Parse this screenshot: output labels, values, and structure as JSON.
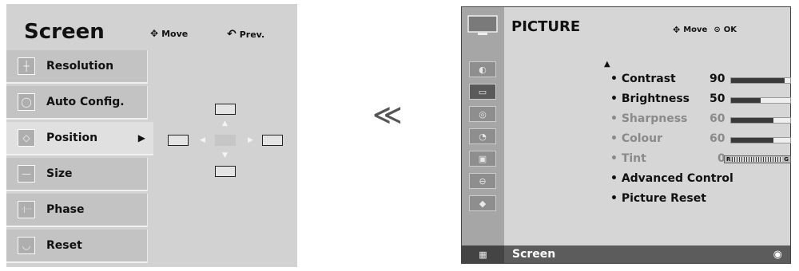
{
  "screen_menu": {
    "title": "Screen",
    "move_hint": "Move",
    "prev_hint": "Prev.",
    "items": [
      {
        "label": "Resolution",
        "icon": "resolution-icon"
      },
      {
        "label": "Auto Config.",
        "icon": "auto-config-icon"
      },
      {
        "label": "Position",
        "icon": "position-icon",
        "selected": true
      },
      {
        "label": "Size",
        "icon": "size-icon"
      },
      {
        "label": "Phase",
        "icon": "phase-icon"
      },
      {
        "label": "Reset",
        "icon": "reset-icon"
      }
    ]
  },
  "separator": "≪",
  "picture_menu": {
    "title": "PICTURE",
    "move_hint": "Move",
    "ok_hint": "OK",
    "rows": [
      {
        "label": "• Contrast",
        "value": "90",
        "level": 90
      },
      {
        "label": "• Brightness",
        "value": "50",
        "level": 50
      },
      {
        "label": "• Sharpness",
        "value": "60",
        "level": 60,
        "dim": true
      },
      {
        "label": "• Colour",
        "value": "60",
        "level": 60,
        "dim": true
      },
      {
        "label": "• Tint",
        "value": "0",
        "dim": true,
        "tint_left": "R",
        "tint_right": "G"
      },
      {
        "label": "• Advanced Control"
      },
      {
        "label": "• Picture Reset"
      }
    ],
    "footer": "Screen",
    "colors": {
      "accent": "#3a3a3a",
      "selected_bg": "#5c5c5c"
    }
  }
}
